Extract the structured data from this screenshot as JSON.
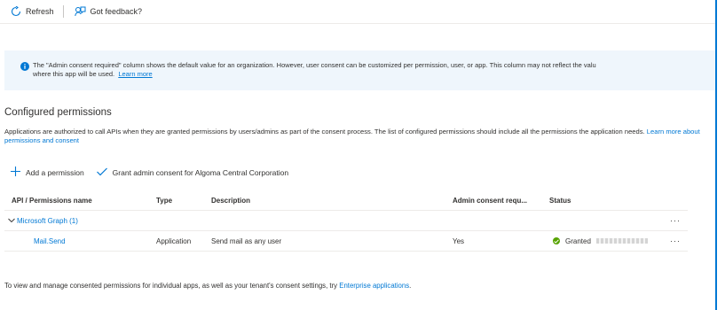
{
  "toolbar": {
    "refresh_label": "Refresh",
    "feedback_label": "Got feedback?"
  },
  "info_bar": {
    "line1": "The \"Admin consent required\" column shows the default value for an organization. However, user consent can be customized per permission, user, or app. This column may not reflect the valu",
    "line2": "where this app will be used.",
    "learn_more": "Learn more"
  },
  "section": {
    "title": "Configured permissions",
    "description": "Applications are authorized to call APIs when they are granted permissions by users/admins as part of the consent process. The list of configured permissions should include all the permissions the application needs.",
    "description_link": "Learn more about permissions and consent"
  },
  "actions": {
    "add_permission": "Add a permission",
    "grant_consent": "Grant admin consent for Algoma Central Corporation"
  },
  "table": {
    "headers": {
      "api": "API / Permissions name",
      "type": "Type",
      "description": "Description",
      "admin_consent": "Admin consent requ...",
      "status": "Status"
    },
    "group": {
      "label": "Microsoft Graph (1)"
    },
    "rows": [
      {
        "name": "Mail.Send",
        "type": "Application",
        "description": "Send mail as any user",
        "admin_consent": "Yes",
        "status": "Granted"
      }
    ],
    "more_label": "···"
  },
  "footer": {
    "text": "To view and manage consented permissions for individual apps, as well as your tenant's consent settings, try",
    "link": "Enterprise applications",
    "end": "."
  },
  "colors": {
    "accent": "#0078d4",
    "info_bg": "#eff6fc",
    "success": "#57a300"
  },
  "icons": {
    "refresh": "refresh-icon",
    "feedback": "feedback-icon",
    "info": "info-icon",
    "add": "plus-icon",
    "grant": "checkmark-icon",
    "chevron": "chevron-down-icon",
    "status": "success-check-icon",
    "more": "more-icon"
  }
}
